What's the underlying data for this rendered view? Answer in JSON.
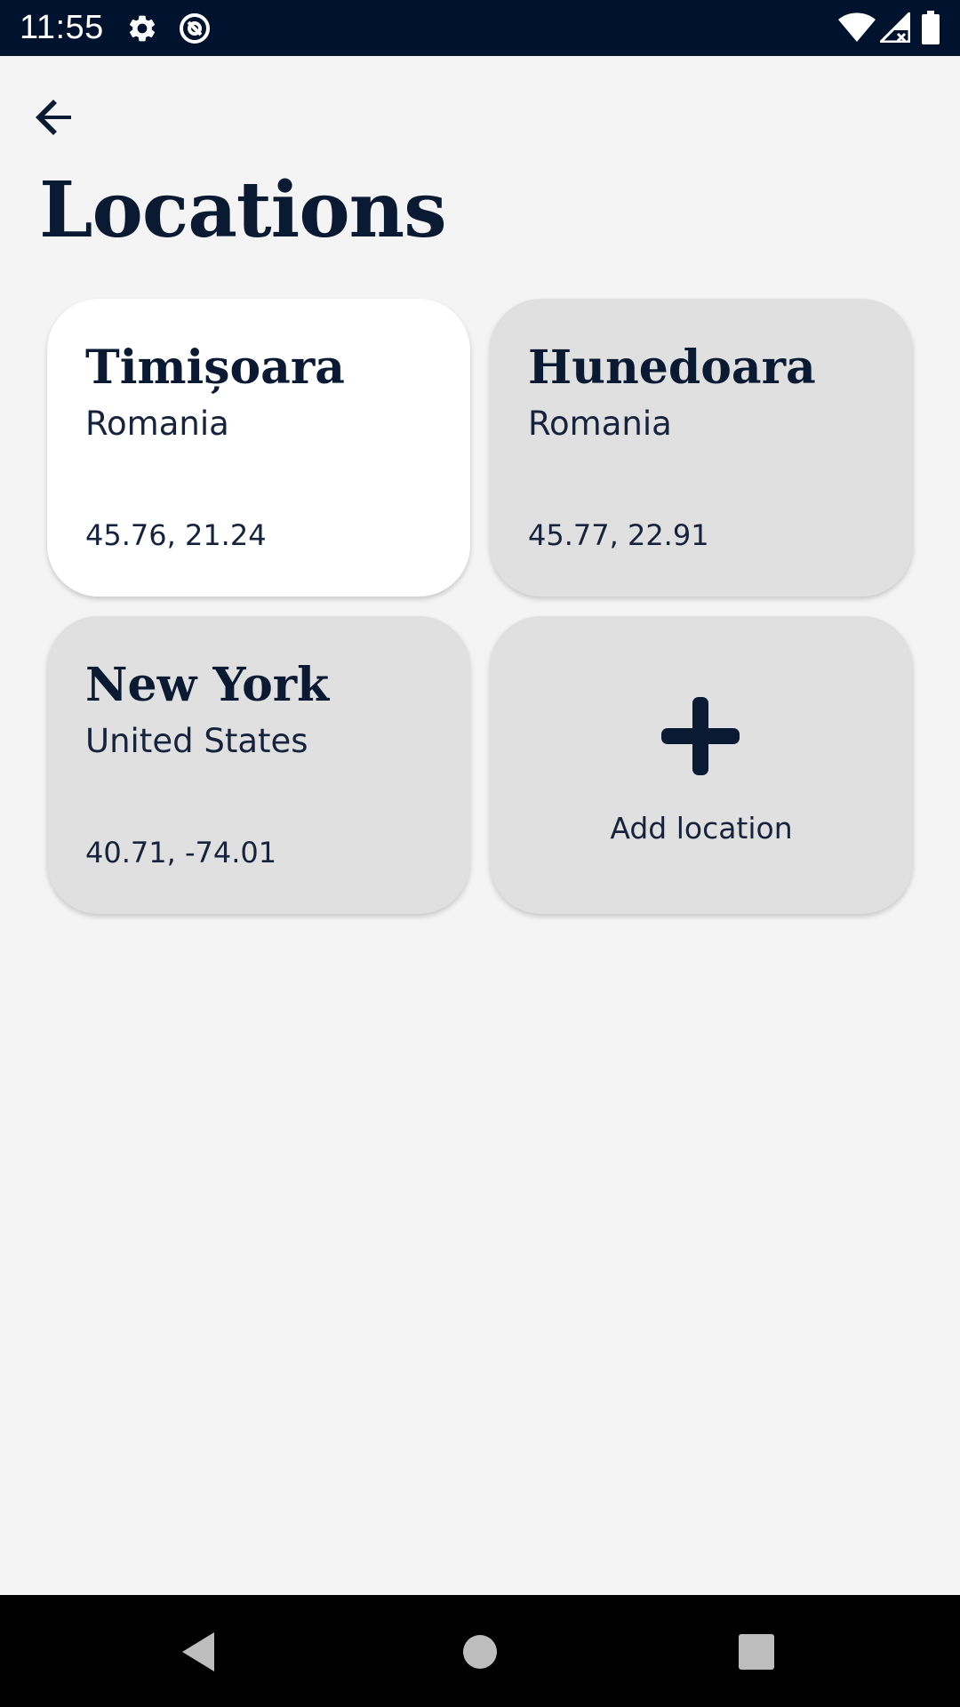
{
  "status_bar": {
    "time": "11:55",
    "icons": [
      "settings-icon",
      "at-sign-icon",
      "wifi-icon",
      "cellular-signal-icon",
      "battery-icon"
    ]
  },
  "header": {
    "back_icon": "arrow-left-icon",
    "title": "Locations"
  },
  "locations": [
    {
      "city": "Timișoara",
      "country": "Romania",
      "coords": "45.76, 21.24",
      "selected": true
    },
    {
      "city": "Hunedoara",
      "country": "Romania",
      "coords": "45.77, 22.91",
      "selected": false
    },
    {
      "city": "New York",
      "country": "United States",
      "coords": "40.71, -74.01",
      "selected": false
    }
  ],
  "add_card": {
    "icon": "plus-icon",
    "label": "Add location"
  },
  "nav_bar": {
    "icons": [
      "nav-back-icon",
      "nav-home-icon",
      "nav-recents-icon"
    ]
  },
  "colors": {
    "status_bar_bg": "#00132e",
    "page_bg": "#f4f4f4",
    "card_bg": "#e0e0e0",
    "card_selected_bg": "#ffffff",
    "text_primary": "#0a1a33"
  }
}
